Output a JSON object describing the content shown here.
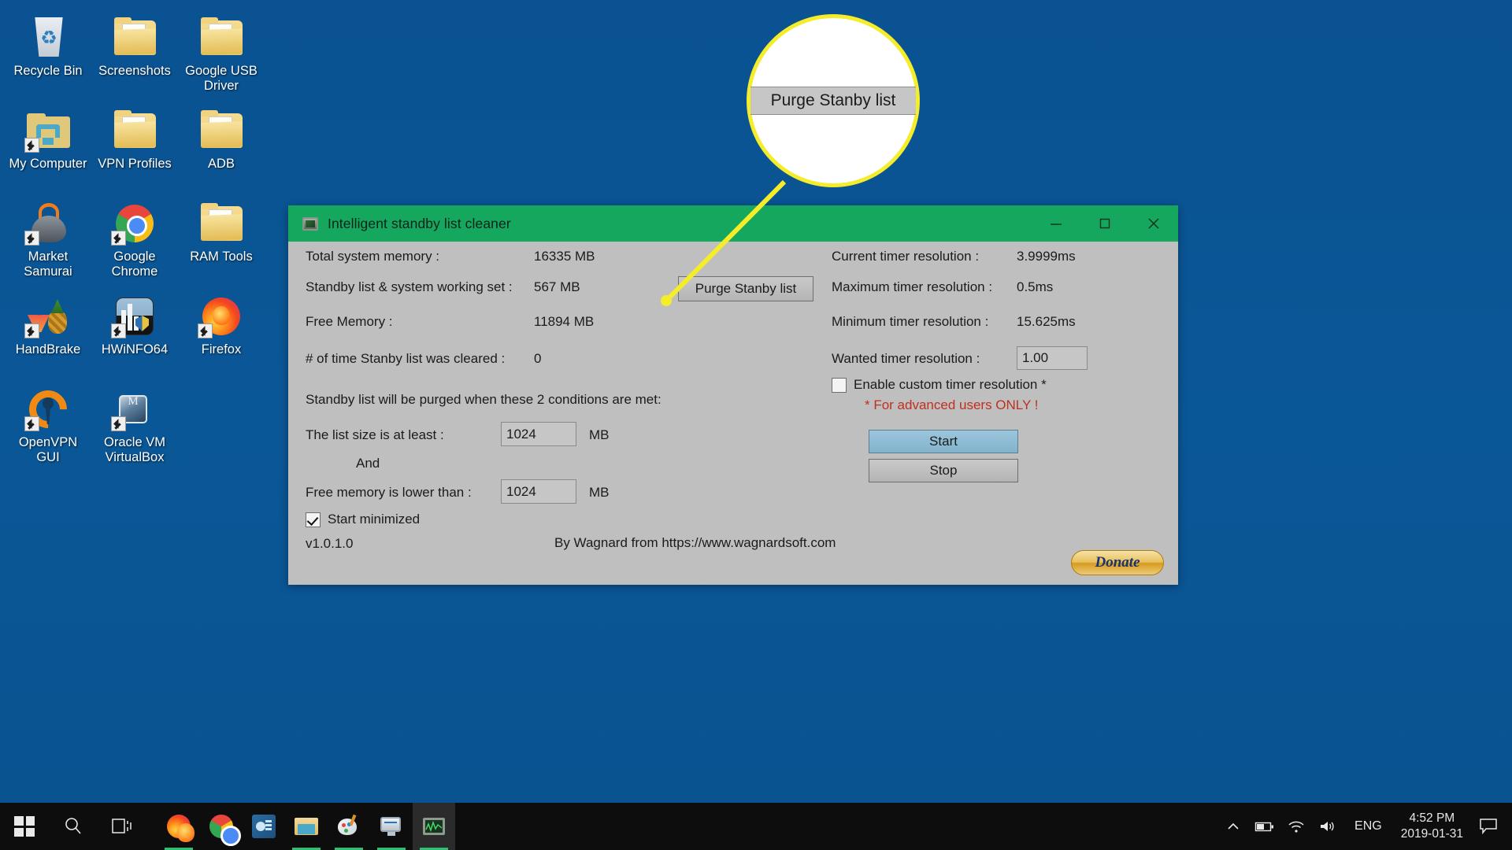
{
  "desktop": {
    "icons": [
      {
        "label": "Recycle Bin",
        "icon": "recycle-bin-icon"
      },
      {
        "label": "Screenshots",
        "icon": "folder-icon"
      },
      {
        "label": "Google USB Driver",
        "icon": "folder-icon"
      },
      {
        "label": "My Computer",
        "icon": "my-computer-icon"
      },
      {
        "label": "VPN Profiles",
        "icon": "folder-icon"
      },
      {
        "label": "ADB",
        "icon": "folder-icon"
      },
      {
        "label": "Market Samurai",
        "icon": "market-samurai-icon"
      },
      {
        "label": "Google Chrome",
        "icon": "chrome-icon"
      },
      {
        "label": "RAM Tools",
        "icon": "folder-icon"
      },
      {
        "label": "HandBrake",
        "icon": "handbrake-icon"
      },
      {
        "label": "HWiNFO64",
        "icon": "hwinfo64-icon"
      },
      {
        "label": "Firefox",
        "icon": "firefox-icon"
      },
      {
        "label": "OpenVPN GUI",
        "icon": "openvpn-icon"
      },
      {
        "label": "Oracle VM VirtualBox",
        "icon": "virtualbox-icon"
      }
    ]
  },
  "window": {
    "title": "Intelligent standby list cleaner",
    "title_bar_color": "#16a75e",
    "controls": {
      "minimize": "minimize-icon",
      "maximize": "maximize-icon",
      "close": "close-icon"
    },
    "left_column": [
      {
        "label": "Total system memory :",
        "value": "16335 MB"
      },
      {
        "label": "Standby list & system working set :",
        "value": "567 MB"
      },
      {
        "label": "Free Memory :",
        "value": "11894 MB"
      },
      {
        "label": "# of time Stanby list was cleared :",
        "value": "0"
      }
    ],
    "purge_button": "Purge Stanby list",
    "right_column": [
      {
        "label": "Current timer resolution :",
        "value": "3.9999ms"
      },
      {
        "label": "Maximum timer resolution :",
        "value": "0.5ms"
      },
      {
        "label": "Minimum timer resolution :",
        "value": "15.625ms"
      }
    ],
    "wanted_timer": {
      "label": "Wanted timer resolution :",
      "value": "1.00"
    },
    "custom_timer_checkbox": {
      "label": "Enable custom timer resolution *",
      "checked": false
    },
    "advanced_warning": "* For advanced users ONLY !",
    "advanced_warning_color": "#c03020",
    "conditions_heading": "Standby list will be purged when these 2 conditions are met:",
    "condition_1": {
      "label": "The list size is at least :",
      "value": "1024",
      "unit": "MB"
    },
    "and_label": "And",
    "condition_2": {
      "label": "Free memory is lower than :",
      "value": "1024",
      "unit": "MB"
    },
    "start_minimized": {
      "label": "Start minimized",
      "checked": true
    },
    "start_button": "Start",
    "stop_button": "Stop",
    "version": "v1.0.1.0",
    "credit": "By Wagnard from https://www.wagnardsoft.com",
    "donate_button": "Donate"
  },
  "callout": {
    "text": "Purge Stanby list",
    "ring_color": "#f5ed2a"
  },
  "taskbar": {
    "start": "windows-start-icon",
    "search": "search-icon",
    "task_view": "task-view-icon",
    "pinned": [
      {
        "name": "firefox-taskbar-icon",
        "running": true
      },
      {
        "name": "chrome-taskbar-icon",
        "running": false
      },
      {
        "name": "excel-taskbar-icon",
        "running": false
      },
      {
        "name": "file-explorer-taskbar-icon",
        "running": true
      },
      {
        "name": "paint-taskbar-icon",
        "running": true
      },
      {
        "name": "monitor-taskbar-icon",
        "running": true
      },
      {
        "name": "islc-taskbar-icon",
        "running": true,
        "active": true
      }
    ],
    "tray": {
      "chevron": "show-hidden-icons-chevron",
      "battery": "battery-icon",
      "network": "wifi-icon",
      "volume": "volume-icon",
      "language": "ENG",
      "time": "4:52 PM",
      "date": "2019-01-31",
      "action_center": "action-center-icon"
    }
  }
}
